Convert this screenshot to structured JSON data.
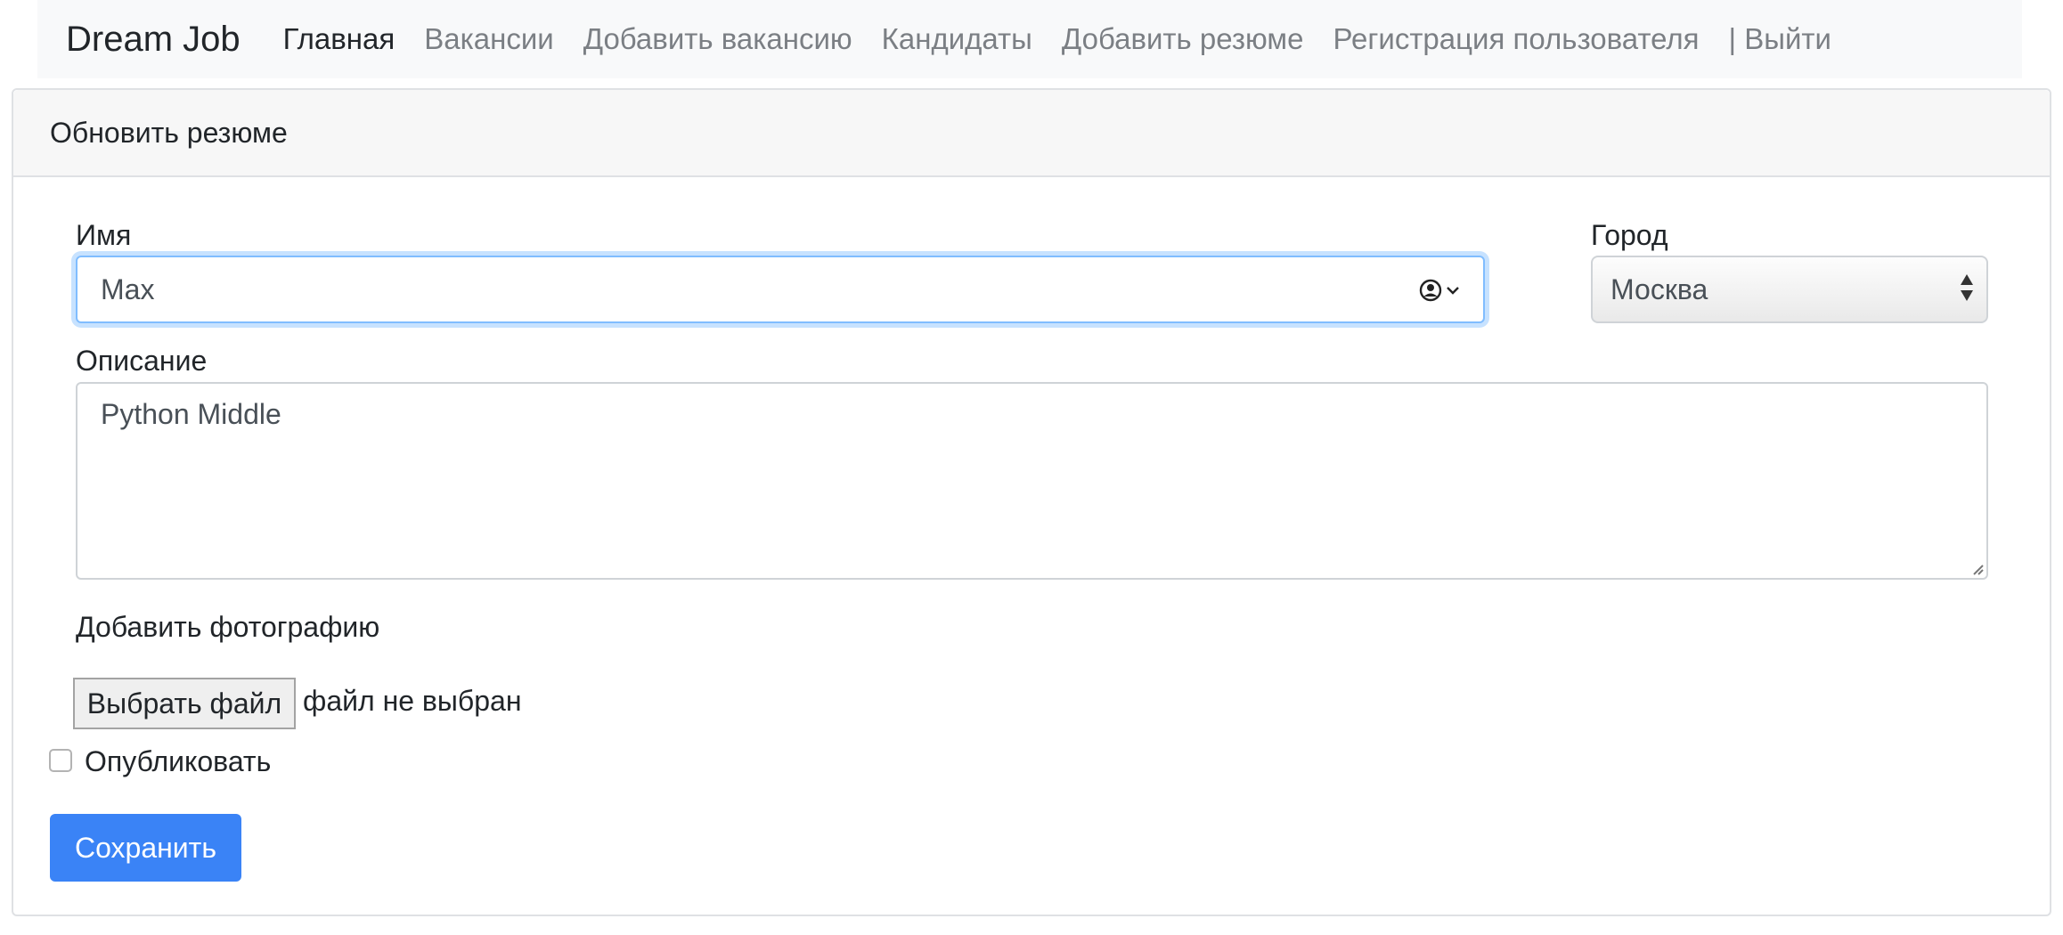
{
  "navbar": {
    "brand": "Dream Job",
    "links": [
      {
        "label": "Главная"
      },
      {
        "label": "Вакансии"
      },
      {
        "label": "Добавить вакансию"
      },
      {
        "label": "Кандидаты"
      },
      {
        "label": "Добавить резюме"
      },
      {
        "label": "Регистрация пользователя"
      },
      {
        "label": "| Выйти"
      }
    ]
  },
  "card": {
    "title": "Обновить резюме"
  },
  "form": {
    "name_label": "Имя",
    "name_value": "Max",
    "name_icon": "person-circle-icon",
    "city_label": "Город",
    "city_value": "Москва",
    "description_label": "Описание",
    "description_value": "Python Middle",
    "photo_label": "Добавить фотографию",
    "file_button": "Выбрать файл",
    "file_status": "файл не выбран",
    "publish_label": "Опубликовать",
    "publish_checked": false,
    "save_button": "Сохранить"
  },
  "colors": {
    "primary": "#3a83f6",
    "focus_border": "#80bdff",
    "nav_bg": "#f8f9fa",
    "muted_link": "#7b7f84"
  }
}
